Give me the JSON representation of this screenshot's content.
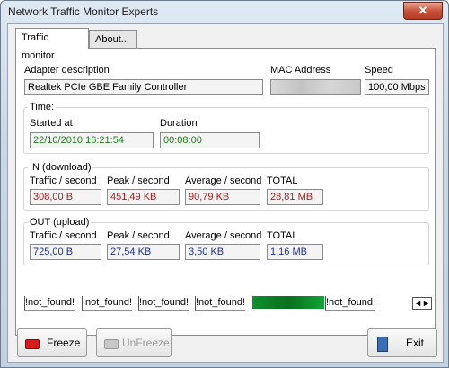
{
  "window": {
    "title": "Network Traffic Monitor Experts",
    "close_glyph": "✕"
  },
  "tabs": [
    {
      "label": "Traffic monitor"
    },
    {
      "label": "About..."
    }
  ],
  "adapter": {
    "desc_label": "Adapter description",
    "desc_value": "Realtek PCIe GBE Family Controller",
    "mac_label": "MAC Address",
    "speed_label": "Speed",
    "speed_value": "100,00 Mbps"
  },
  "time": {
    "group_label": "Time:",
    "started_label": "Started at",
    "started_value": "22/10/2010 16:21:54",
    "duration_label": "Duration",
    "duration_value": "00:08:00"
  },
  "in": {
    "group_label": "IN (download)",
    "traffic_label": "Traffic / second",
    "traffic_value": "308,00 B",
    "peak_label": "Peak / second",
    "peak_value": "451,49 KB",
    "average_label": "Average / second",
    "average_value": "90,79 KB",
    "total_label": "TOTAL",
    "total_value": "28,81 MB"
  },
  "out": {
    "group_label": "OUT (upload)",
    "traffic_label": "Traffic / second",
    "traffic_value": "725,00 B",
    "peak_label": "Peak / second",
    "peak_value": "27,54 KB",
    "average_label": "Average / second",
    "average_value": "3,50 KB",
    "total_label": "TOTAL",
    "total_value": "1,16 MB"
  },
  "interface_tabs": [
    {
      "label": "!not_found!"
    },
    {
      "label": "!not_found!"
    },
    {
      "label": "!not_found!"
    },
    {
      "label": "!not_found!"
    },
    {
      "label": "!not_found!"
    }
  ],
  "nav_arrows": "◄►",
  "buttons": {
    "freeze": "Freeze",
    "unfreeze": "UnFreeze",
    "exit": "Exit"
  },
  "colors": {
    "in_values": "#b01919",
    "out_values": "#1c2f9a",
    "time_values": "#1f7a1f"
  }
}
